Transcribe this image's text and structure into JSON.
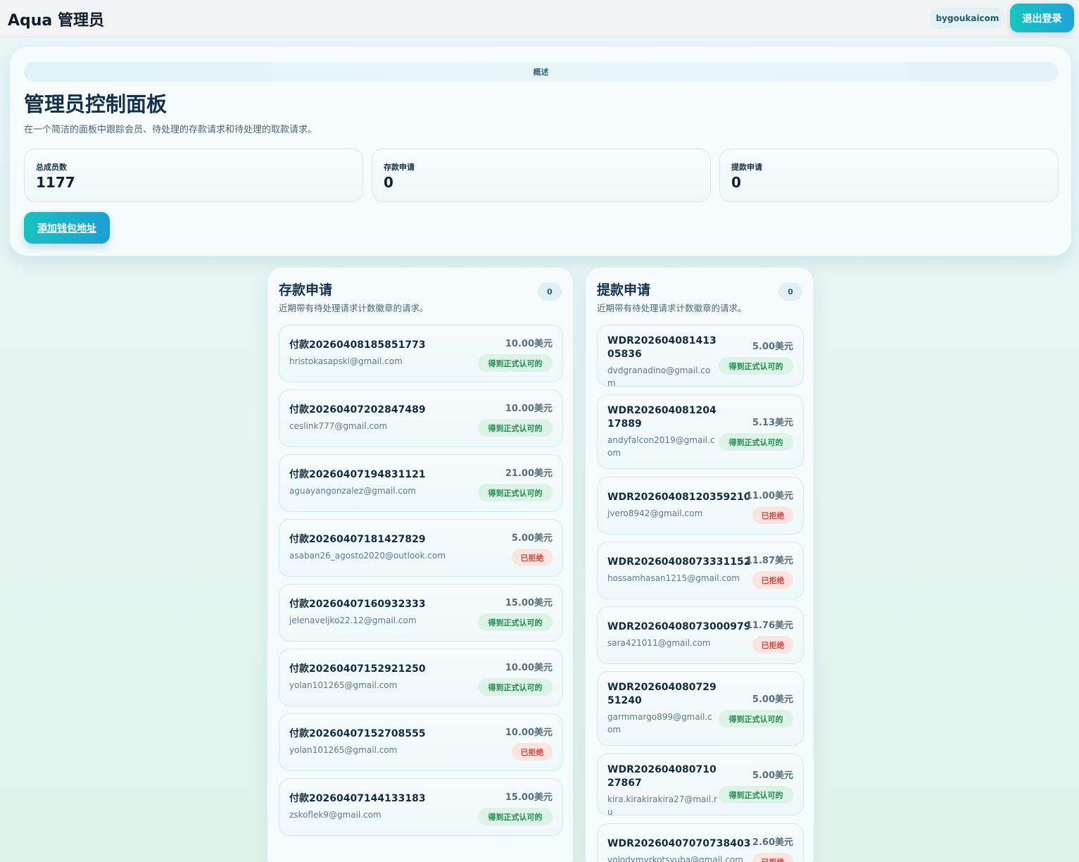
{
  "header": {
    "app_title": "Aqua 管理员",
    "user_label": "bygoukaicom",
    "logout_label": "退出登录"
  },
  "overview": {
    "pill_label": "概述",
    "title": "管理员控制面板",
    "subtitle": "在一个简洁的面板中跟踪会员、待处理的存款请求和待处理的取款请求。",
    "stats": [
      {
        "label": "总成员数",
        "value": "1177"
      },
      {
        "label": "存款申请",
        "value": "0"
      },
      {
        "label": "提款申请",
        "value": "0"
      }
    ],
    "add_wallet_label": "添加钱包地址"
  },
  "deposits": {
    "title": "存款申请",
    "subtitle": "近期带有待处理请求计数徽章的请求。",
    "count": "0",
    "items": [
      {
        "id": "付款20260408185851773",
        "email": "hristokasapski@gmail.com",
        "amount": "10.00美元",
        "status": "得到正式认可的"
      },
      {
        "id": "付款20260407202847489",
        "email": "ceslink777@gmail.com",
        "amount": "10.00美元",
        "status": "得到正式认可的"
      },
      {
        "id": "付款20260407194831121",
        "email": "aguayangonzalez@gmail.com",
        "amount": "21.00美元",
        "status": "得到正式认可的"
      },
      {
        "id": "付款20260407181427829",
        "email": "asaban26_agosto2020@outlook.com",
        "amount": "5.00美元",
        "status": "已拒绝"
      },
      {
        "id": "付款20260407160932333",
        "email": "jelenaveljko22.12@gmail.com",
        "amount": "15.00美元",
        "status": "得到正式认可的"
      },
      {
        "id": "付款20260407152921250",
        "email": "yolan101265@gmail.com",
        "amount": "10.00美元",
        "status": "得到正式认可的"
      },
      {
        "id": "付款20260407152708555",
        "email": "yolan101265@gmail.com",
        "amount": "10.00美元",
        "status": "已拒绝"
      },
      {
        "id": "付款20260407144133183",
        "email": "zskoflek9@gmail.com",
        "amount": "15.00美元",
        "status": "得到正式认可的"
      }
    ]
  },
  "withdrawals": {
    "title": "提款申请",
    "subtitle": "近期带有待处理请求计数徽章的请求。",
    "count": "0",
    "items": [
      {
        "id": "WDR20260408141305836",
        "email": "dvdgranadino@gmail.com",
        "amount": "5.00美元",
        "status": "得到正式认可的"
      },
      {
        "id": "WDR20260408120417889",
        "email": "andyfalcon2019@gmail.com",
        "amount": "5.13美元",
        "status": "得到正式认可的"
      },
      {
        "id": "WDR20260408120359210",
        "email": "jvero8942@gmail.com",
        "amount": "11.00美元",
        "status": "已拒绝"
      },
      {
        "id": "WDR20260408073331152",
        "email": "hossamhasan1215@gmail.com",
        "amount": "11.87美元",
        "status": "已拒绝"
      },
      {
        "id": "WDR20260408073000979",
        "email": "sara421011@gmail.com",
        "amount": "11.76美元",
        "status": "已拒绝"
      },
      {
        "id": "WDR20260408072951240",
        "email": "garmmargo899@gmail.com",
        "amount": "5.00美元",
        "status": "得到正式认可的"
      },
      {
        "id": "WDR20260408071027867",
        "email": "kira.kirakirakira27@mail.ru",
        "amount": "5.00美元",
        "status": "得到正式认可的"
      },
      {
        "id": "WDR20260407070738403",
        "email": "volodymyrkotsyuba@gmail.com",
        "amount": "2.60美元",
        "status": "已拒绝"
      }
    ]
  }
}
